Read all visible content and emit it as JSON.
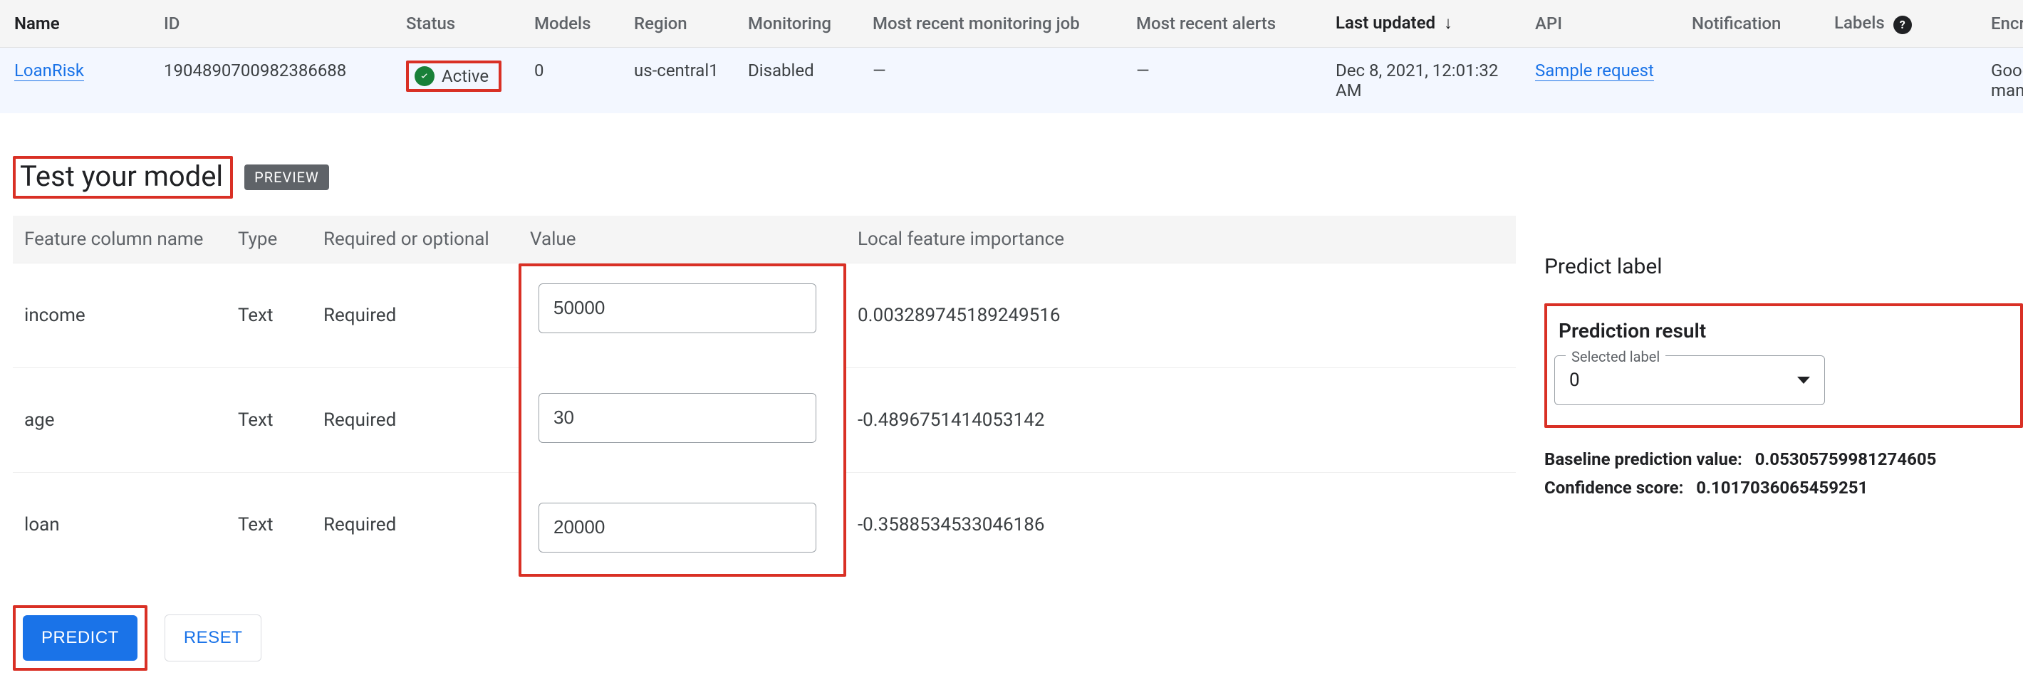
{
  "models_table": {
    "headers": {
      "name": "Name",
      "id": "ID",
      "status": "Status",
      "models": "Models",
      "region": "Region",
      "monitoring": "Monitoring",
      "most_recent_monitoring_job": "Most recent monitoring job",
      "most_recent_alerts": "Most recent alerts",
      "last_updated": "Last updated",
      "sort_glyph": "↓",
      "api": "API",
      "notification": "Notification",
      "labels": "Labels",
      "labels_help": "?",
      "encryption": "Encryption"
    },
    "row": {
      "name": "LoanRisk",
      "id": "1904890700982386688",
      "status": "Active",
      "models": "0",
      "region": "us-central1",
      "monitoring": "Disabled",
      "most_recent_monitoring_job": "—",
      "most_recent_alerts": "—",
      "last_updated": "Dec 8, 2021, 12:01:32 AM",
      "api": "Sample request",
      "notification": "",
      "labels": "",
      "encryption": "Google-managed key"
    }
  },
  "test_section": {
    "title": "Test your model",
    "preview_badge": "PREVIEW",
    "feature_headers": {
      "name": "Feature column name",
      "type": "Type",
      "required": "Required or optional",
      "value": "Value",
      "importance": "Local feature importance"
    },
    "features": [
      {
        "name": "income",
        "type": "Text",
        "required": "Required",
        "value": "50000",
        "importance": "0.003289745189249516"
      },
      {
        "name": "age",
        "type": "Text",
        "required": "Required",
        "value": "30",
        "importance": "-0.4896751414053142"
      },
      {
        "name": "loan",
        "type": "Text",
        "required": "Required",
        "value": "20000",
        "importance": "-0.3588534533046186"
      }
    ],
    "buttons": {
      "predict": "PREDICT",
      "reset": "RESET"
    }
  },
  "predict_panel": {
    "title": "Predict label",
    "result_heading": "Prediction result",
    "select_label": "Selected label",
    "selected_value": "0",
    "baseline_label": "Baseline prediction value:",
    "baseline_value": "0.05305759981274605",
    "confidence_label": "Confidence score:",
    "confidence_value": "0.1017036065459251"
  }
}
